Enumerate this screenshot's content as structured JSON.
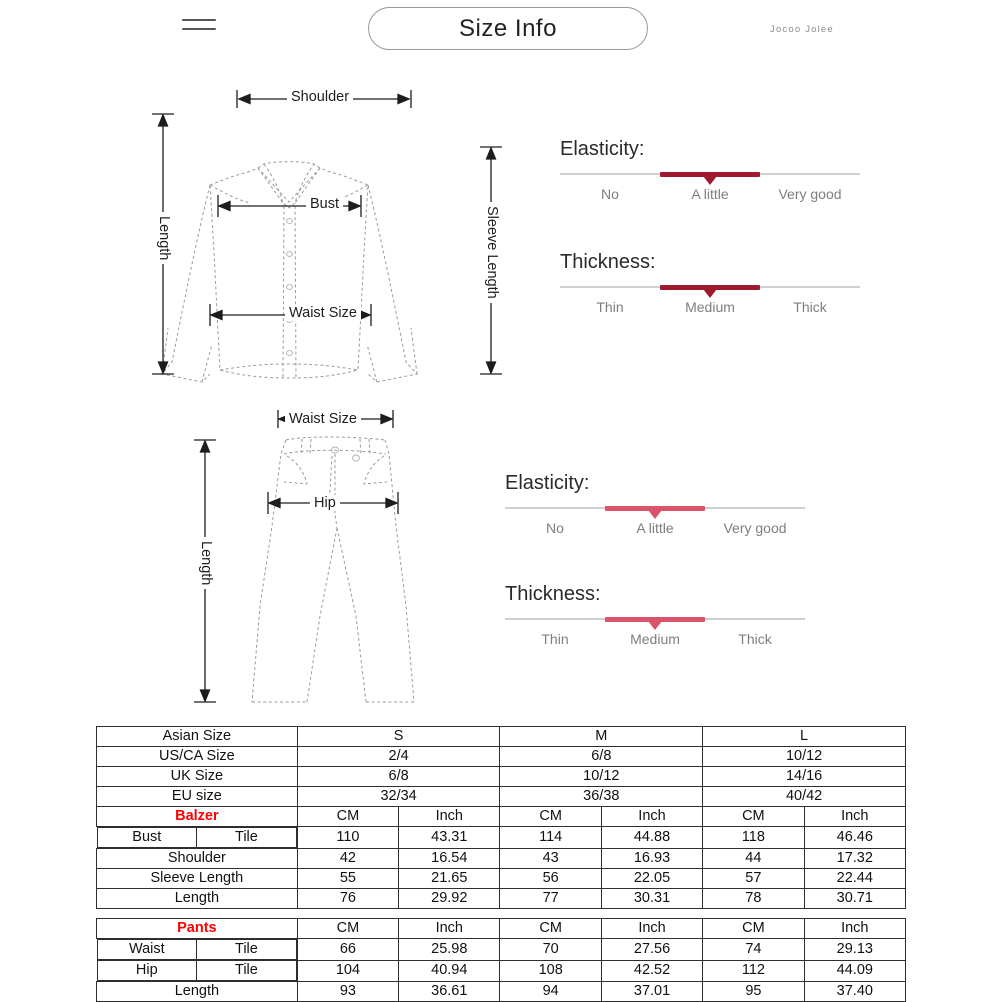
{
  "header": {
    "menu_icon": "hamburger-icon",
    "title": "Size Info",
    "brand": "Jocoo Jolee"
  },
  "top_diagram": {
    "name": "shirt-measurement-diagram",
    "labels": {
      "shoulder": "Shoulder",
      "bust": "Bust",
      "waist": "Waist Size",
      "length": "Length",
      "sleeve_length": "Sleeve Length"
    }
  },
  "bottom_diagram": {
    "name": "pants-measurement-diagram",
    "labels": {
      "waist": "Waist Size",
      "hip": "Hip",
      "length": "Length"
    }
  },
  "top_specs": {
    "accent_color": "#9e1b2f",
    "elasticity": {
      "title": "Elasticity:",
      "ticks": [
        "No",
        "A little",
        "Very good"
      ],
      "selected": "A little"
    },
    "thickness": {
      "title": "Thickness:",
      "ticks": [
        "Thin",
        "Medium",
        "Thick"
      ],
      "selected": "Medium"
    }
  },
  "bottom_specs": {
    "accent_color": "#d9536b",
    "elasticity": {
      "title": "Elasticity:",
      "ticks": [
        "No",
        "A little",
        "Very good"
      ],
      "selected": "A little"
    },
    "thickness": {
      "title": "Thickness:",
      "ticks": [
        "Thin",
        "Medium",
        "Thick"
      ],
      "selected": "Medium"
    }
  },
  "chart_data": {
    "type": "table",
    "title": "Size Info",
    "tables": [
      {
        "name": "blazer-size-table",
        "category": "Balzer",
        "category_color": "#ff0000",
        "size_rows": [
          {
            "label": "Asian Size",
            "values": [
              "S",
              "M",
              "L"
            ]
          },
          {
            "label": "US/CA Size",
            "values": [
              "2/4",
              "6/8",
              "10/12"
            ]
          },
          {
            "label": "UK Size",
            "values": [
              "6/8",
              "10/12",
              "14/16"
            ]
          },
          {
            "label": "EU size",
            "values": [
              "32/34",
              "36/38",
              "40/42"
            ]
          }
        ],
        "unit_header": [
          "CM",
          "Inch",
          "CM",
          "Inch",
          "CM",
          "Inch"
        ],
        "measure_rows": [
          {
            "label": "Bust",
            "sub_label": "Tile",
            "values": [
              "110",
              "43.31",
              "114",
              "44.88",
              "118",
              "46.46"
            ]
          },
          {
            "label": "Shoulder",
            "sub_label": "",
            "values": [
              "42",
              "16.54",
              "43",
              "16.93",
              "44",
              "17.32"
            ]
          },
          {
            "label": "Sleeve Length",
            "sub_label": "",
            "values": [
              "55",
              "21.65",
              "56",
              "22.05",
              "57",
              "22.44"
            ]
          },
          {
            "label": "Length",
            "sub_label": "",
            "values": [
              "76",
              "29.92",
              "77",
              "30.31",
              "78",
              "30.71"
            ]
          }
        ]
      },
      {
        "name": "pants-size-table",
        "category": "Pants",
        "category_color": "#ff0000",
        "unit_header": [
          "CM",
          "Inch",
          "CM",
          "Inch",
          "CM",
          "Inch"
        ],
        "measure_rows": [
          {
            "label": "Waist",
            "sub_label": "Tile",
            "values": [
              "66",
              "25.98",
              "70",
              "27.56",
              "74",
              "29.13"
            ]
          },
          {
            "label": "Hip",
            "sub_label": "Tile",
            "values": [
              "104",
              "40.94",
              "108",
              "42.52",
              "112",
              "44.09"
            ]
          },
          {
            "label": "Length",
            "sub_label": "",
            "values": [
              "93",
              "36.61",
              "94",
              "37.01",
              "95",
              "37.40"
            ]
          }
        ]
      }
    ]
  }
}
